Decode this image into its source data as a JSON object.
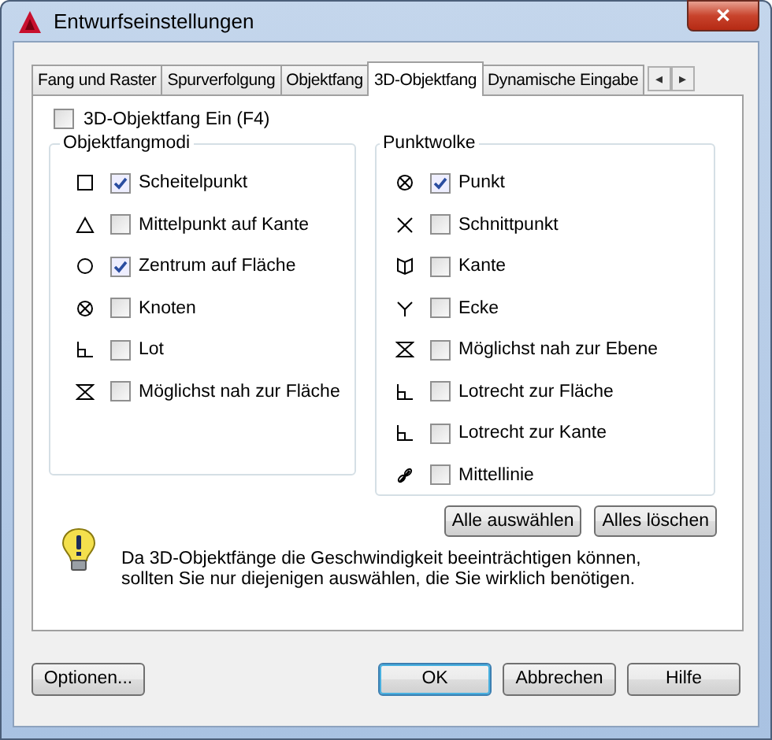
{
  "window": {
    "title": "Entwurfseinstellungen",
    "close": "✕"
  },
  "tabs": [
    {
      "label": "Fang und Raster",
      "selected": false
    },
    {
      "label": "Spurverfolgung",
      "selected": false
    },
    {
      "label": "Objektfang",
      "selected": false
    },
    {
      "label": "3D-Objektfang",
      "selected": true
    },
    {
      "label": "Dynamische Eingabe",
      "selected": false
    }
  ],
  "tab_scroll": [
    "◂",
    "▸"
  ],
  "enable": {
    "label": "3D-Objektfang Ein (F4)",
    "checked": false
  },
  "groups": [
    {
      "title": "Objektfangmodi",
      "items": [
        {
          "label": "Scheitelpunkt",
          "checked": true
        },
        {
          "label": "Mittelpunkt auf Kante",
          "checked": false
        },
        {
          "label": "Zentrum auf Fläche",
          "checked": true
        },
        {
          "label": "Knoten",
          "checked": false
        },
        {
          "label": "Lot",
          "checked": false
        },
        {
          "label": "Möglichst nah zur Fläche",
          "checked": false
        }
      ]
    },
    {
      "title": "Punktwolke",
      "items": [
        {
          "label": "Punkt",
          "checked": true
        },
        {
          "label": "Schnittpunkt",
          "checked": false
        },
        {
          "label": "Kante",
          "checked": false
        },
        {
          "label": "Ecke",
          "checked": false
        },
        {
          "label": "Möglichst nah zur Ebene",
          "checked": false
        },
        {
          "label": "Lotrecht zur Fläche",
          "checked": false
        },
        {
          "label": "Lotrecht zur Kante",
          "checked": false
        },
        {
          "label": "Mittellinie",
          "checked": false
        }
      ]
    }
  ],
  "group_buttons": [
    "Alle auswählen",
    "Alles löschen"
  ],
  "note": "Da 3D-Objektfänge die Geschwindigkeit beeinträchtigen können, sollten Sie nur diejenigen auswählen, die Sie wirklich benötigen.",
  "footer_left": "Optionen...",
  "footer_buttons": [
    {
      "label": "OK",
      "default": true
    },
    {
      "label": "Abbrechen",
      "default": false
    },
    {
      "label": "Hilfe",
      "default": false
    }
  ]
}
